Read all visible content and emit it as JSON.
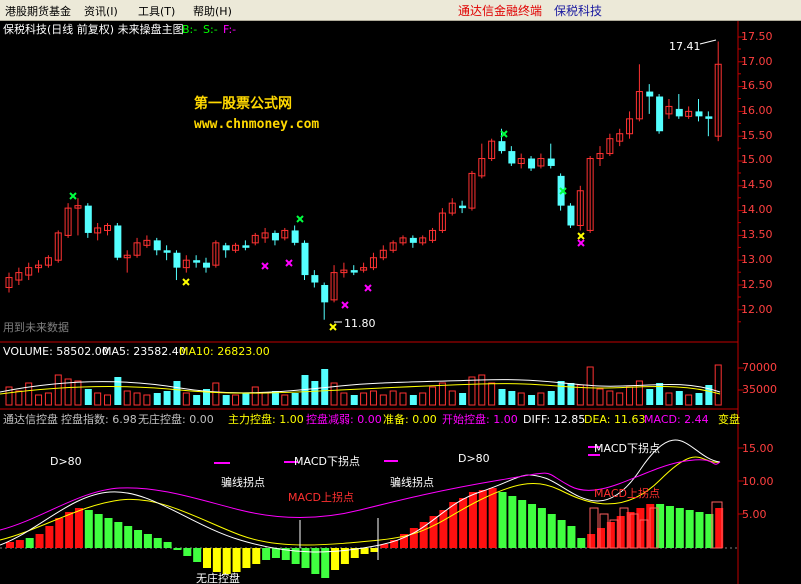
{
  "menu": {
    "items": [
      "港股期货基金",
      "资讯(I)",
      "工具(T)",
      "帮助(H)"
    ],
    "brand_left": "通达信金融终端",
    "brand_right": "保税科技"
  },
  "main_chart": {
    "title": "保税科技(日线 前复权) 未来操盘主图",
    "flags": [
      "B:-",
      "S:-",
      "F:-"
    ],
    "flag_colors": [
      "#00ff00",
      "#00ff00",
      "#ff00ff"
    ],
    "watermark_line1": "第一股票公式网",
    "watermark_line2": "www.chnmoney.com",
    "high_label": "17.41",
    "low_label": "11.80",
    "bottom_note": "用到未来数据",
    "y_ticks": [
      "17.50",
      "17.00",
      "16.50",
      "16.00",
      "15.50",
      "15.00",
      "14.50",
      "14.00",
      "13.50",
      "13.00",
      "12.50",
      "12.00"
    ],
    "colors": {
      "up": "#ff3232",
      "down": "#54ffff",
      "axis": "#c00000",
      "tick": "#ff4040"
    }
  },
  "volume_panel": {
    "label_volume": "VOLUME: 58502.00",
    "label_ma5": "MA5: 23582.40",
    "label_ma10": "MA10: 26823.00",
    "y_ticks": [
      "70000",
      "35000"
    ]
  },
  "indicator_panel": {
    "labels": [
      {
        "text": "通达信控盘",
        "color": "#c0c0c0"
      },
      {
        "text": "控盘指数: 6.98",
        "color": "#c0c0c0"
      },
      {
        "text": "无庄控盘: 0.00",
        "color": "#c0c0c0"
      },
      {
        "text": "主力控盘: 1.00",
        "color": "#ffff00"
      },
      {
        "text": "控盘减弱: 0.00",
        "color": "#ff00ff"
      },
      {
        "text": "准备: 0.00",
        "color": "#ffff00"
      },
      {
        "text": "开始控盘: 1.00",
        "color": "#ff00ff"
      },
      {
        "text": "DIFF: 12.85",
        "color": "#ffffff"
      },
      {
        "text": "DEA: 11.63",
        "color": "#ffff00"
      },
      {
        "text": "MACD: 2.44",
        "color": "#ff00ff"
      },
      {
        "text": "变盘",
        "color": "#ffff00"
      }
    ],
    "annotations": [
      "D>80",
      "MACD下拐点",
      "骗线拐点",
      "MACD上拐点",
      "骗线拐点",
      "D>80",
      "MACD下拐点",
      "MACD上拐点"
    ],
    "bottom_text": "无庄控盘",
    "y_ticks": [
      "15.00",
      "10.00",
      "5.00"
    ]
  }
}
